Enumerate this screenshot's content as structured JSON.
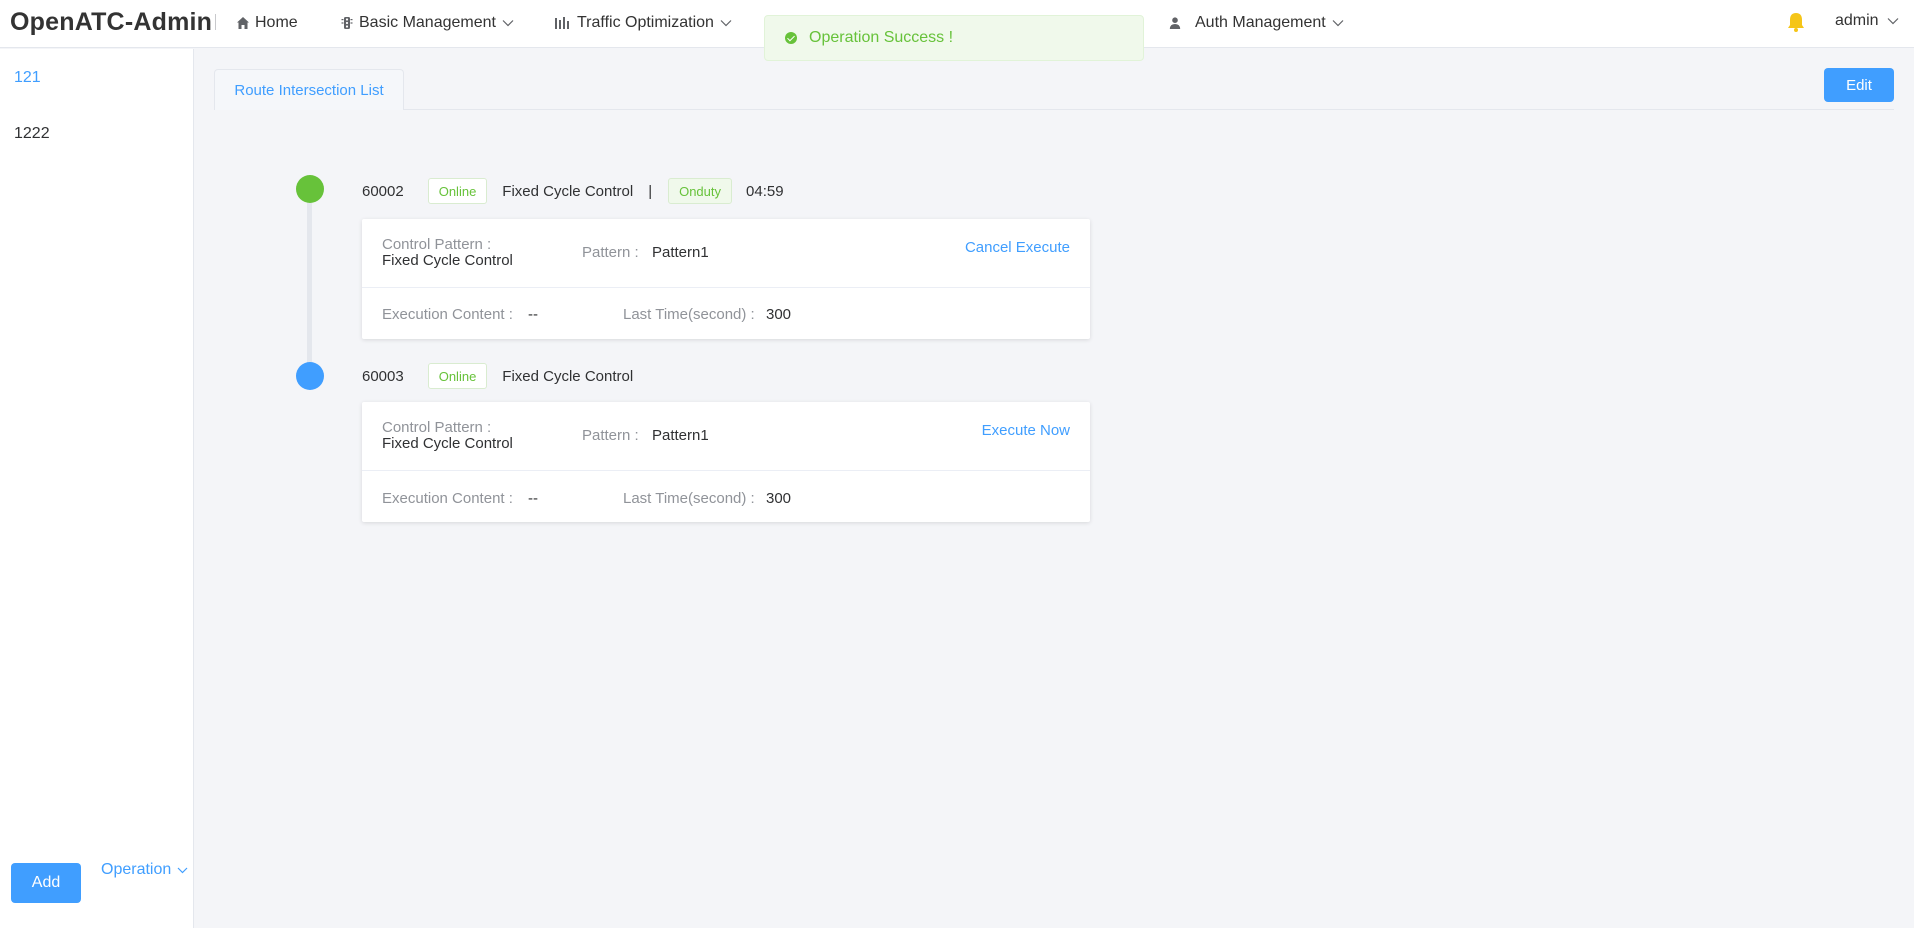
{
  "app": {
    "title": "OpenATC-Admin"
  },
  "nav": {
    "home": "Home",
    "basic": "Basic Management",
    "traffic": "Traffic Optimization",
    "auth": "Auth Management",
    "user": "admin"
  },
  "toast": {
    "message": "Operation Success !"
  },
  "sidebar": {
    "items": [
      {
        "label": "121",
        "active": true
      },
      {
        "label": "1222",
        "active": false
      }
    ],
    "add_label": "Add",
    "operation_label": "Operation"
  },
  "main": {
    "tab": "Route Intersection List",
    "edit_label": "Edit",
    "intersections": [
      {
        "id": "60002",
        "status": "Online",
        "control": "Fixed Cycle Control",
        "separator": "|",
        "duty": "Onduty",
        "time": "04:59",
        "control_pattern_label": "Control Pattern :",
        "control_pattern_value": "Fixed Cycle Control",
        "pattern_label": "Pattern :",
        "pattern_value": "Pattern1",
        "action": "Cancel Execute",
        "exec_label": "Execution Content :",
        "exec_value": "--",
        "last_time_label": "Last Time(second) :",
        "last_time_value": "300"
      },
      {
        "id": "60003",
        "status": "Online",
        "control": "Fixed Cycle Control",
        "control_pattern_label": "Control Pattern :",
        "control_pattern_value": "Fixed Cycle Control",
        "pattern_label": "Pattern :",
        "pattern_value": "Pattern1",
        "action": "Execute Now",
        "exec_label": "Execution Content :",
        "exec_value": "--",
        "last_time_label": "Last Time(second) :",
        "last_time_value": "300"
      }
    ]
  },
  "colors": {
    "primary": "#409eff",
    "success": "#67c23a",
    "bell": "#f5c518"
  }
}
